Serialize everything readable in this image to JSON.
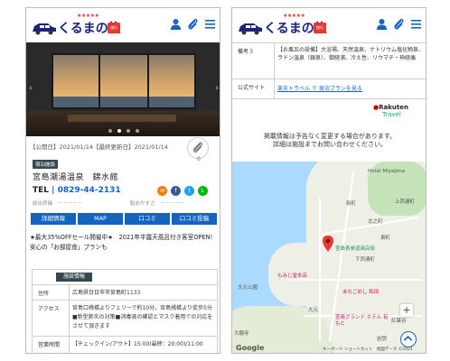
{
  "brand": {
    "logo_text": "くるまの旅",
    "stars": "★★★★★",
    "tag": "旅行"
  },
  "left": {
    "published": "【公開日】2021/01/14【最終更新日】2021/01/14",
    "clip_count": "0",
    "category_badge": "宿泊施設",
    "name": "宮島潮湯温泉　錦水館",
    "tel_label": "TEL",
    "tel_number": "0829-44-2131",
    "rating_general_label": "総合評価",
    "rating_general_value": "－－－－－",
    "rating_ease_label": "駐めやすさ",
    "rating_ease_value": "－－－－－",
    "tabs": [
      "詳細情報",
      "MAP",
      "口コミ",
      "口コミ投稿"
    ],
    "promo": "★最大35%OFFセール開催中★　2021年半露天風呂付き客室OPEN!安心の「お部屋食」プランも",
    "section_title": "施設情報",
    "rows": [
      {
        "label": "住所",
        "value": "広島県廿日市市宮島町1133"
      },
      {
        "label": "アクセス",
        "value": "宮島口桟橋よりフェリーで約10分。宮島桟橋より徒歩5分 ■新型肺炎の対策■消毒液の確認とマスク着用での対応をさせて頂きます"
      },
      {
        "label": "営業時間",
        "value": "【チェックイン/アウト】15:00(最終：20:00)/11:00"
      }
    ]
  },
  "right": {
    "rows": [
      {
        "label": "備考３",
        "value": "【お風呂の設備】大浴場、天然温泉、ナトリウム塩化物泉、ラドン温泉（銀泉）、御経浦、冷え性、リウマチ・神経痛"
      },
      {
        "label": "公式サイト",
        "value": "楽天トラベル で 宿泊プランを見る"
      }
    ],
    "rakuten": "Rakuten",
    "travel": "Travel",
    "notice_line1": "掲載情報は予告なく変更する場合があります。",
    "notice_line2": "詳細は施設までお問い合わせください。"
  },
  "map": {
    "labels": {
      "hotel": "Hotel Miyajima",
      "kami": "上西連町",
      "shimo": "下西連町",
      "cafe": "宮島表参道商店街",
      "momiji": "もみじ堂本店",
      "anago": "あなごめし 和田",
      "omoto": "大元公園",
      "ohmoto2": "大元",
      "grand": "宮島グランド ホテル 有もと",
      "kamiya": "岩惣",
      "ohnishi": "大願寺",
      "iwaso": "紅葉谷",
      "shi": "新町",
      "kita": "北之町",
      "higashi": "東町"
    },
    "google": "Google",
    "attrib": "キーボード ショートカット　地図データ ©2021"
  },
  "colors": {
    "navy": "#1a237e",
    "accent_blue": "#1565c0",
    "red": "#e53935",
    "badge_dark": "#37474f"
  }
}
